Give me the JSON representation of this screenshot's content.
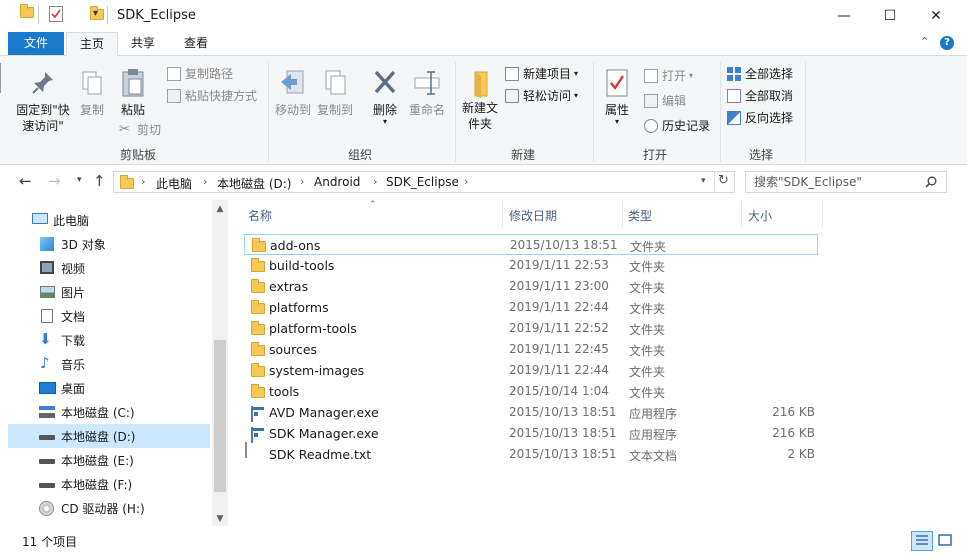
{
  "window": {
    "title": "SDK_Eclipse",
    "minimize_glyph": "—",
    "maximize_glyph": "☐",
    "close_glyph": "✕"
  },
  "ribbon_tabs": [
    {
      "label": "文件"
    },
    {
      "label": "主页"
    },
    {
      "label": "共享"
    },
    {
      "label": "查看"
    }
  ],
  "ribbon": {
    "clipboard": {
      "pin_label": "固定到\"快速访问\"",
      "copy_label": "复制",
      "paste_label": "粘贴",
      "copy_path_label": "复制路径",
      "paste_shortcut_label": "粘贴快捷方式",
      "cut_label": "剪切",
      "group_label": "剪贴板"
    },
    "organize": {
      "move_to_label": "移动到",
      "copy_to_label": "复制到",
      "delete_label": "删除",
      "rename_label": "重命名",
      "group_label": "组织"
    },
    "new": {
      "new_folder_label": "新建文件夹",
      "new_item_label": "新建项目",
      "easy_access_label": "轻松访问",
      "group_label": "新建"
    },
    "open": {
      "properties_label": "属性",
      "open_label": "打开",
      "edit_label": "编辑",
      "history_label": "历史记录",
      "group_label": "打开"
    },
    "select": {
      "select_all_label": "全部选择",
      "select_none_label": "全部取消",
      "invert_label": "反向选择",
      "group_label": "选择"
    }
  },
  "address": {
    "crumbs": [
      "此电脑",
      "本地磁盘 (D:)",
      "Android",
      "SDK_Eclipse"
    ],
    "search_placeholder": "搜索\"SDK_Eclipse\""
  },
  "nav_pane": {
    "items": [
      {
        "label": "此电脑",
        "icon": "pc-icon"
      },
      {
        "label": "3D 对象",
        "icon": "3d-objects-icon"
      },
      {
        "label": "视频",
        "icon": "video-icon"
      },
      {
        "label": "图片",
        "icon": "pictures-icon"
      },
      {
        "label": "文档",
        "icon": "documents-icon"
      },
      {
        "label": "下载",
        "icon": "download-icon"
      },
      {
        "label": "音乐",
        "icon": "music-icon"
      },
      {
        "label": "桌面",
        "icon": "desktop-icon"
      },
      {
        "label": "本地磁盘 (C:)",
        "icon": "system-drive-icon"
      },
      {
        "label": "本地磁盘 (D:)",
        "icon": "drive-icon",
        "selected": true
      },
      {
        "label": "本地磁盘 (E:)",
        "icon": "drive-icon"
      },
      {
        "label": "本地磁盘 (F:)",
        "icon": "drive-icon"
      },
      {
        "label": "CD 驱动器 (H:)",
        "icon": "cd-drive-icon"
      }
    ]
  },
  "file_list": {
    "columns": {
      "name": "名称",
      "modified": "修改日期",
      "type": "类型",
      "size": "大小"
    },
    "rows": [
      {
        "name": "add-ons",
        "modified": "2015/10/13 18:51",
        "type": "文件夹",
        "size": "",
        "icon": "folder-icon"
      },
      {
        "name": "build-tools",
        "modified": "2019/1/11 22:53",
        "type": "文件夹",
        "size": "",
        "icon": "folder-icon"
      },
      {
        "name": "extras",
        "modified": "2019/1/11 23:00",
        "type": "文件夹",
        "size": "",
        "icon": "folder-icon"
      },
      {
        "name": "platforms",
        "modified": "2019/1/11 22:44",
        "type": "文件夹",
        "size": "",
        "icon": "folder-icon"
      },
      {
        "name": "platform-tools",
        "modified": "2019/1/11 22:52",
        "type": "文件夹",
        "size": "",
        "icon": "folder-icon"
      },
      {
        "name": "sources",
        "modified": "2019/1/11 22:45",
        "type": "文件夹",
        "size": "",
        "icon": "folder-icon"
      },
      {
        "name": "system-images",
        "modified": "2019/1/11 22:44",
        "type": "文件夹",
        "size": "",
        "icon": "folder-icon"
      },
      {
        "name": "tools",
        "modified": "2015/10/14 1:04",
        "type": "文件夹",
        "size": "",
        "icon": "folder-icon"
      },
      {
        "name": "AVD Manager.exe",
        "modified": "2015/10/13 18:51",
        "type": "应用程序",
        "size": "216 KB",
        "icon": "exe-icon"
      },
      {
        "name": "SDK Manager.exe",
        "modified": "2015/10/13 18:51",
        "type": "应用程序",
        "size": "216 KB",
        "icon": "exe-icon"
      },
      {
        "name": "SDK Readme.txt",
        "modified": "2015/10/13 18:51",
        "type": "文本文档",
        "size": "2 KB",
        "icon": "text-file-icon"
      }
    ]
  },
  "status": {
    "item_count": "11 个项目"
  },
  "colors": {
    "accent": "#1979ca",
    "selection": "#cce8ff",
    "focus_border": "#99d1ff",
    "folder": "#f6c854"
  }
}
